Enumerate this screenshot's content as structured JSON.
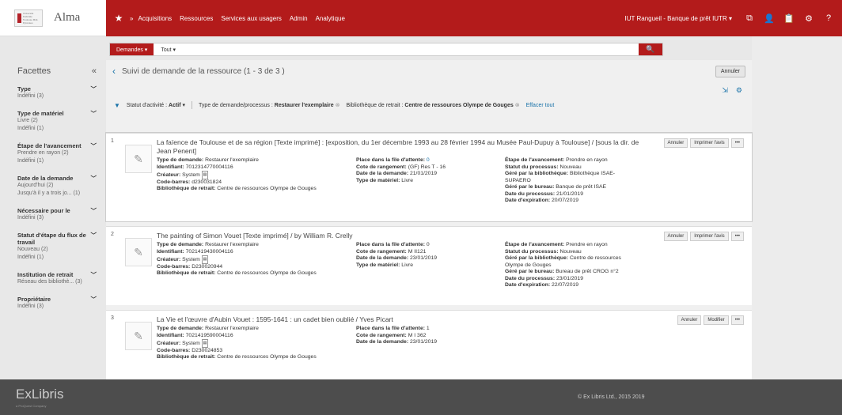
{
  "brand": {
    "name": "Alma",
    "logo_text": "Université Fédérale Toulouse Midi-Pyrénées"
  },
  "nav": {
    "items": [
      "Acquisitions",
      "Ressources",
      "Services aux usagers",
      "Admin",
      "Analytique"
    ],
    "institution": "IUT Rangueil - Banque de prêt IUTR ▾"
  },
  "search": {
    "type": "Demandes ▾",
    "scope": "Tout  ▾"
  },
  "facets": {
    "title": "Facettes",
    "collapse": "«",
    "groups": [
      {
        "title": "Type",
        "values": [
          "Indéfini (3)"
        ]
      },
      {
        "title": "Type de matériel",
        "values": [
          "Livre (2)",
          "Indéfini (1)"
        ]
      },
      {
        "title": "Étape de l'avancement",
        "values": [
          "Prendre en rayon (2)",
          "Indéfini (1)"
        ]
      },
      {
        "title": "Date de la demande",
        "values": [
          "Aujourd'hui (2)",
          "Jusqu'à il y a trois jo... (1)"
        ]
      },
      {
        "title": "Nécessaire pour le",
        "values": [
          "Indéfini (3)"
        ]
      },
      {
        "title": "Statut d'étape du flux de travail",
        "values": [
          "Nouveau (2)",
          "Indéfini (1)"
        ]
      },
      {
        "title": "Institution de retrait",
        "values": [
          "Réseau des bibliothè... (3)"
        ]
      },
      {
        "title": "Propriétaire",
        "values": [
          "Indéfini (3)"
        ]
      }
    ]
  },
  "main": {
    "title": "Suivi de demande de la ressource (1 - 3 de 3 )",
    "cancel": "Annuler",
    "filters": {
      "status_label": "Statut d'activité : ",
      "status_value": "Actif",
      "type_label": "Type de demande/processus : ",
      "type_value": "Restaurer l'exemplaire",
      "lib_label": "Bibliothèque de retrait : ",
      "lib_value": "Centre de ressources Olympe de Gouges",
      "clear": "Effacer tout"
    }
  },
  "labels": {
    "type": "Type de demande:",
    "id": "Identifiant:",
    "creator": "Créateur:",
    "barcode": "Code-barres:",
    "pickup": "Bibliothèque de retrait:",
    "queue": "Place dans la file d'attente:",
    "callno": "Cote de rangement:",
    "date": "Date de la demande:",
    "material": "Type de matériel:",
    "step": "Étape de l'avancement:",
    "pstatus": "Statut du processus:",
    "managedlib": "Géré par la bibliothèque:",
    "managedesk": "Géré par le bureau:",
    "pdate": "Date du processus:",
    "expiry": "Date d'expiration:"
  },
  "requests": [
    {
      "idx": "1",
      "title": "La faïence de Toulouse et de sa région [Texte imprimé] : [exposition, du 1er décembre 1993 au 28 février 1994 au Musée Paul-Dupuy à Toulouse] / [sous la dir. de Jean Penent]",
      "type": "Restaurer l'exemplaire",
      "id": "7012314770004116",
      "creator": "System",
      "barcode": "d230031824",
      "pickup": "Centre de ressources Olympe de Gouges",
      "queue": "0",
      "callno": "(GF) Res T - 16",
      "date": "21/01/2019",
      "material": "Livre",
      "step": "Prendre en rayon",
      "pstatus": "Nouveau",
      "managedlib": "Bibliothèque ISAE-SUPAERO",
      "managedesk": "Banque de prêt ISAE",
      "pdate": "21/01/2019",
      "expiry": "20/07/2019",
      "actions": [
        "Annuler",
        "Imprimer l'avis",
        "•••"
      ]
    },
    {
      "idx": "2",
      "title": "The painting of Simon Vouet [Texte imprimé] / by William R. Crelly",
      "type": "Restaurer l'exemplaire",
      "id": "7021419430004116",
      "creator": "System",
      "barcode": "D230020944",
      "pickup": "Centre de ressources Olympe de Gouges",
      "queue": "0",
      "callno": "M II121",
      "date": "23/01/2019",
      "material": "Livre",
      "step": "Prendre en rayon",
      "pstatus": "Nouveau",
      "managedlib": "Centre de ressources Olympe de Gouges",
      "managedesk": "Bureau de prêt CROG n°2",
      "pdate": "23/01/2019",
      "expiry": "22/07/2019",
      "actions": [
        "Annuler",
        "Imprimer l'avis",
        "•••"
      ]
    },
    {
      "idx": "3",
      "title": "La Vie et l'œuvre d'Aubin Vouet : 1595-1641 : un cadet bien oublié / Yves Picart",
      "type": "Restaurer l'exemplaire",
      "id": "7021419590004116",
      "creator": "System",
      "barcode": "D230024853",
      "pickup": "Centre de ressources Olympe de Gouges",
      "queue": "1",
      "callno": "M I 362",
      "date": "23/01/2019",
      "actions": [
        "Annuler",
        "Modifier",
        "•••"
      ]
    }
  ],
  "footer": {
    "brand": "ExLibris",
    "sub": "a ProQuest Company",
    "copyright": "© Ex Libris Ltd., 2015 2019"
  }
}
